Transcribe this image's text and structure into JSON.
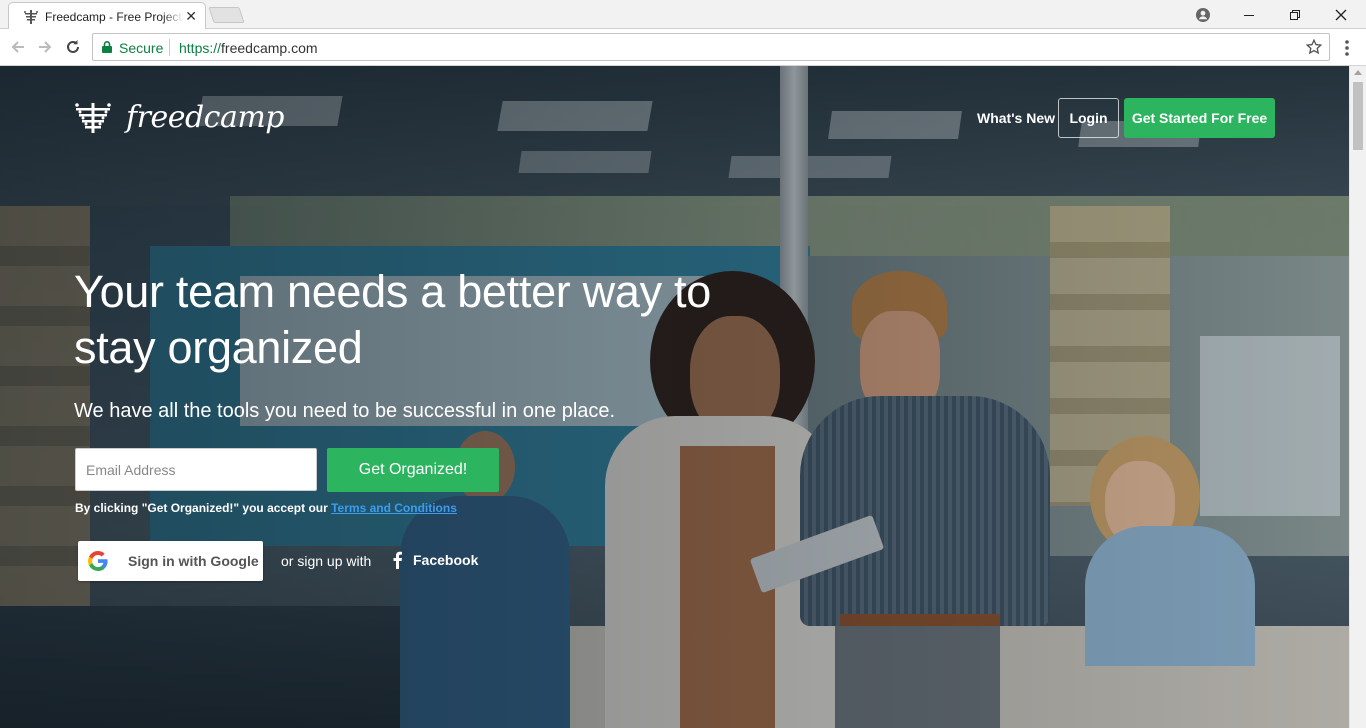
{
  "browser": {
    "tab_title": "Freedcamp - Free Project",
    "secure_label": "Secure",
    "url_scheme": "https://",
    "url_host": "freedcamp.com"
  },
  "header": {
    "logo_text": "freedcamp",
    "whats_new": "What's New",
    "login": "Login",
    "get_started": "Get Started For Free"
  },
  "hero": {
    "headline": "Your team needs a better way to stay organized",
    "subhead": "We have all the tools you need to be successful in one place.",
    "email_placeholder": "Email Address",
    "cta_label": "Get Organized!",
    "terms_prefix": "By clicking \"Get Organized!\" you accept our ",
    "terms_link": "Terms and Conditions",
    "google_label": "Sign in with Google",
    "or_text": "or sign up with",
    "facebook_label": "Facebook"
  },
  "colors": {
    "brand_green": "#2db45f",
    "secure_green": "#0b8043",
    "link_blue": "#3a9df0"
  },
  "icons": [
    "freedcamp-logo-icon",
    "lock-icon",
    "star-icon",
    "google-icon",
    "facebook-icon",
    "back-arrow-icon",
    "forward-arrow-icon",
    "reload-icon",
    "user-icon",
    "menu-icon"
  ]
}
